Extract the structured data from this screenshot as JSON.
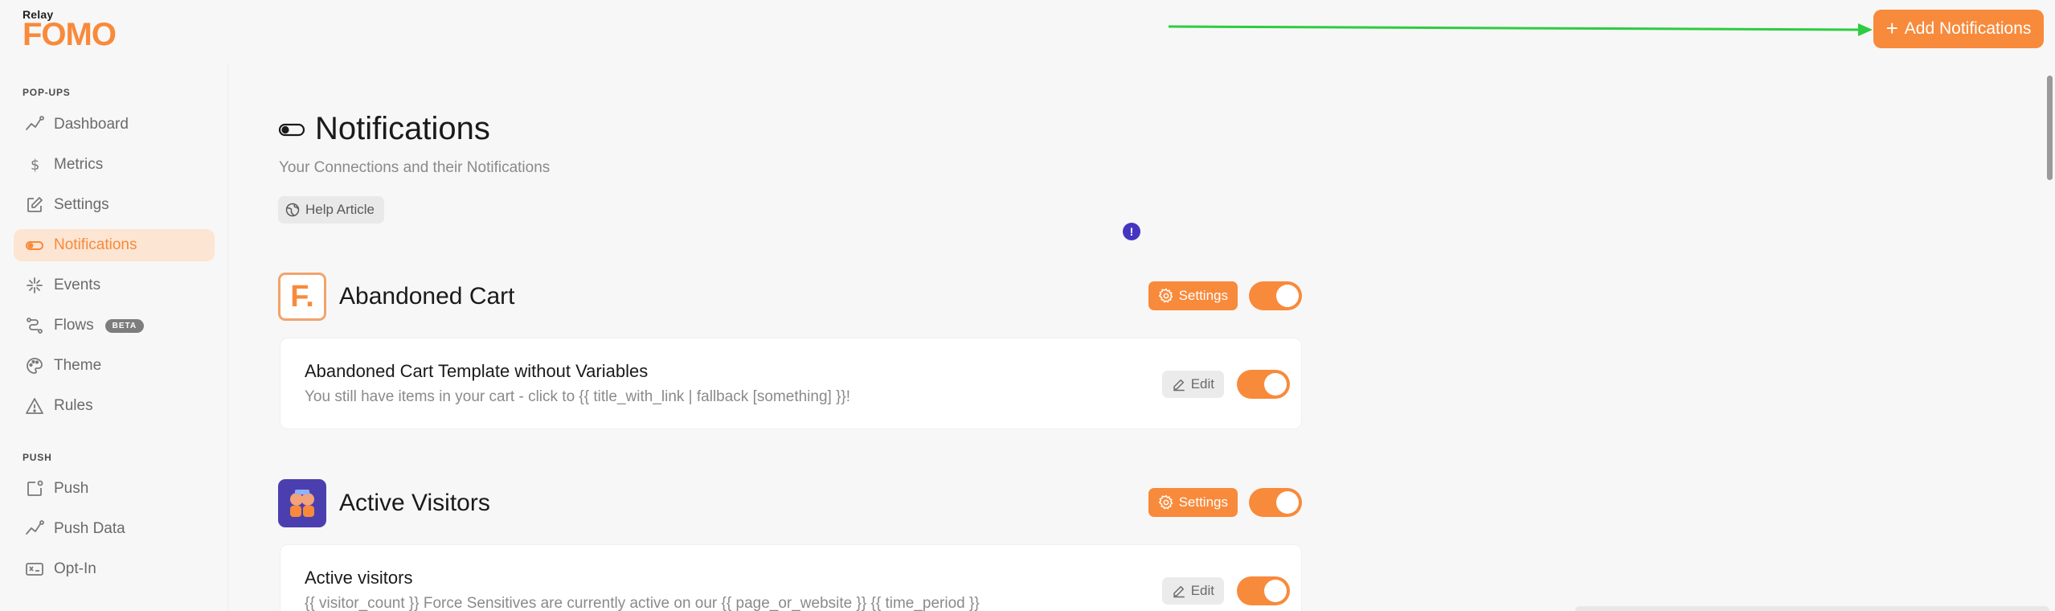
{
  "brand": {
    "super": "Relay",
    "name": "FOMO",
    "accent": "#f88a3b"
  },
  "header": {
    "add_button_label": "Add Notifications"
  },
  "sidebar": {
    "sections": [
      {
        "title": "POP-UPS"
      },
      {
        "title": "PUSH"
      }
    ],
    "items": [
      {
        "label": "Dashboard",
        "icon": "trend-icon"
      },
      {
        "label": "Metrics",
        "icon": "dollar-icon"
      },
      {
        "label": "Settings",
        "icon": "edit-icon"
      },
      {
        "label": "Notifications",
        "icon": "toggle-icon",
        "active": true
      },
      {
        "label": "Events",
        "icon": "sparkle-icon"
      },
      {
        "label": "Flows",
        "icon": "flow-icon",
        "badge": "BETA"
      },
      {
        "label": "Theme",
        "icon": "palette-icon"
      },
      {
        "label": "Rules",
        "icon": "warning-icon"
      },
      {
        "label": "Push",
        "icon": "push-icon"
      },
      {
        "label": "Push Data",
        "icon": "trend-icon"
      },
      {
        "label": "Opt-In",
        "icon": "opt-in-icon"
      }
    ]
  },
  "main": {
    "title": "Notifications",
    "subtitle": "Your Connections and their Notifications",
    "help_label": "Help Article",
    "groups": [
      {
        "name": "Abandoned Cart",
        "settings_label": "Settings",
        "enabled": true,
        "notifications": [
          {
            "title": "Abandoned Cart Template without Variables",
            "description": "You still have items in your cart - click to {{ title_with_link | fallback [something] }}!",
            "edit_label": "Edit",
            "enabled": true
          }
        ]
      },
      {
        "name": "Active Visitors",
        "settings_label": "Settings",
        "enabled": true,
        "notifications": [
          {
            "title": "Active visitors",
            "description": "{{ visitor_count }} Force Sensitives are currently active on our {{ page_or_website }} {{ time_period }}",
            "edit_label": "Edit",
            "enabled": true
          }
        ]
      }
    ],
    "info_badge": "!"
  }
}
